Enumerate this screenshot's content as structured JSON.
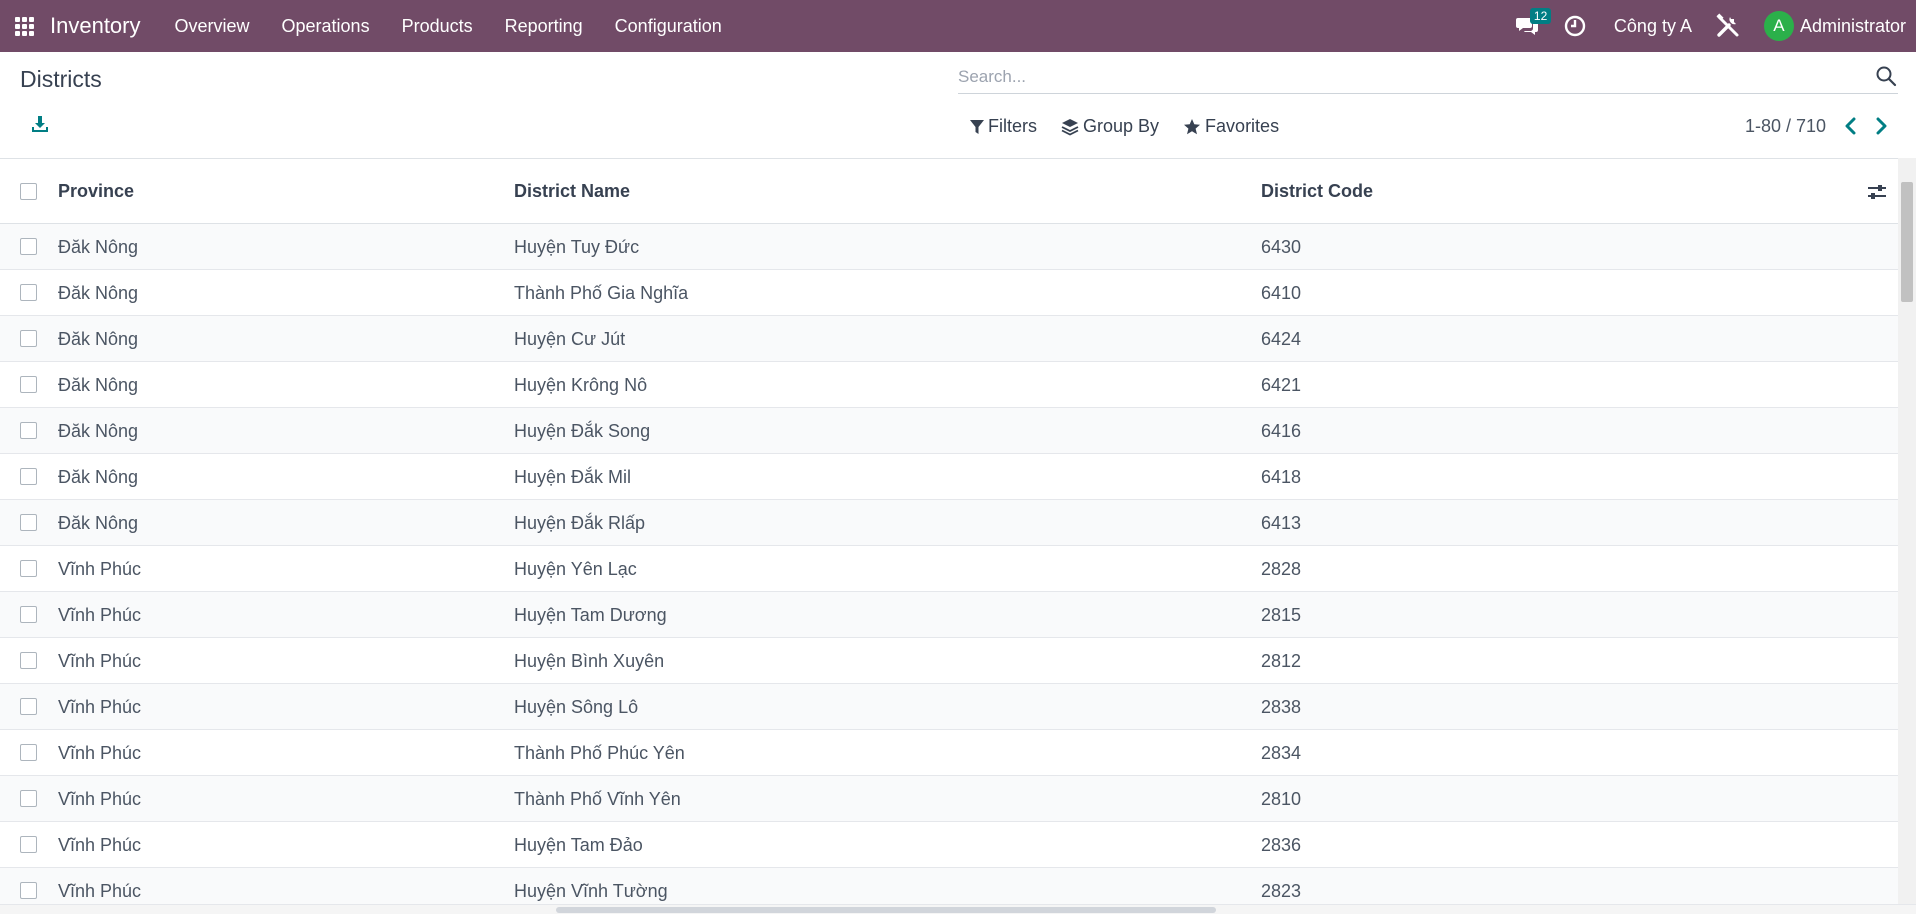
{
  "navbar": {
    "brand": "Inventory",
    "menu": [
      "Overview",
      "Operations",
      "Products",
      "Reporting",
      "Configuration"
    ],
    "chat_badge": "12",
    "company": "Công ty A",
    "avatar_letter": "A",
    "username": "Administrator"
  },
  "control": {
    "title": "Districts",
    "search_placeholder": "Search...",
    "filters_label": "Filters",
    "group_by_label": "Group By",
    "favorites_label": "Favorites",
    "pager_text": "1-80 / 710"
  },
  "table": {
    "headers": {
      "province": "Province",
      "name": "District Name",
      "code": "District Code"
    },
    "rows": [
      {
        "province": "Đăk Nông",
        "name": "Huyện Tuy Đức",
        "code": "6430"
      },
      {
        "province": "Đăk Nông",
        "name": "Thành Phố Gia Nghĩa",
        "code": "6410"
      },
      {
        "province": "Đăk Nông",
        "name": "Huyện Cư Jút",
        "code": "6424"
      },
      {
        "province": "Đăk Nông",
        "name": "Huyện Krông Nô",
        "code": "6421"
      },
      {
        "province": "Đăk Nông",
        "name": "Huyện Đắk Song",
        "code": "6416"
      },
      {
        "province": "Đăk Nông",
        "name": "Huyện Đắk Mil",
        "code": "6418"
      },
      {
        "province": "Đăk Nông",
        "name": "Huyện Đắk Rlấp",
        "code": "6413"
      },
      {
        "province": "Vĩnh Phúc",
        "name": "Huyện Yên Lạc",
        "code": "2828"
      },
      {
        "province": "Vĩnh Phúc",
        "name": "Huyện Tam Dương",
        "code": "2815"
      },
      {
        "province": "Vĩnh Phúc",
        "name": "Huyện Bình Xuyên",
        "code": "2812"
      },
      {
        "province": "Vĩnh Phúc",
        "name": "Huyện Sông Lô",
        "code": "2838"
      },
      {
        "province": "Vĩnh Phúc",
        "name": "Thành Phố Phúc Yên",
        "code": "2834"
      },
      {
        "province": "Vĩnh Phúc",
        "name": "Thành Phố Vĩnh Yên",
        "code": "2810"
      },
      {
        "province": "Vĩnh Phúc",
        "name": "Huyện Tam Đảo",
        "code": "2836"
      },
      {
        "province": "Vĩnh Phúc",
        "name": "Huyện Vĩnh Tường",
        "code": "2823"
      }
    ]
  },
  "icons": {
    "apps": "apps-grid-icon",
    "chat": "chat-icon",
    "activity": "clock-icon",
    "debug": "tools-icon",
    "download": "download-icon",
    "search": "search-icon",
    "filter": "filter-icon",
    "group_by": "layers-icon",
    "favorites": "star-icon",
    "pager_prev": "chevron-left-icon",
    "pager_next": "chevron-right-icon",
    "optional_columns": "sliders-icon"
  },
  "colors": {
    "navbar": "#714B67",
    "accent": "#017e84",
    "avatar": "#2bb04a"
  }
}
